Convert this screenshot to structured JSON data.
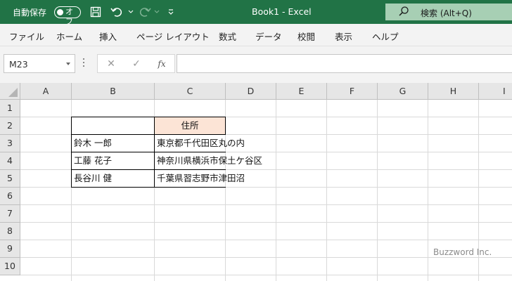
{
  "titlebar": {
    "autosave_label": "自動保存",
    "autosave_state": "オフ",
    "title": "Book1  -  Excel",
    "search_label": "検索 (Alt+Q)"
  },
  "ribbon": {
    "tabs": [
      "ファイル",
      "ホーム",
      "挿入",
      "ページ レイアウト",
      "数式",
      "データ",
      "校閲",
      "表示",
      "ヘルプ"
    ]
  },
  "formula_bar": {
    "name_box": "M23",
    "fx_label": "fx",
    "formula": ""
  },
  "sheet": {
    "columns": [
      "A",
      "B",
      "C",
      "D",
      "E",
      "F",
      "G",
      "H",
      "I"
    ],
    "rows": [
      "1",
      "2",
      "3",
      "4",
      "5",
      "6",
      "7",
      "8",
      "9",
      "10"
    ],
    "cells": {
      "C2": "住所",
      "B3": "鈴木 一郎",
      "C3": "東京都千代田区丸の内",
      "B4": "工藤 花子",
      "C4": "神奈川県横浜市保土ケ谷区",
      "B5": "長谷川 健",
      "C5": "千葉県習志野市津田沼"
    },
    "header_fill": "#fce4d6"
  },
  "watermark": "Buzzword Inc.",
  "colors": {
    "accent": "#217346"
  }
}
